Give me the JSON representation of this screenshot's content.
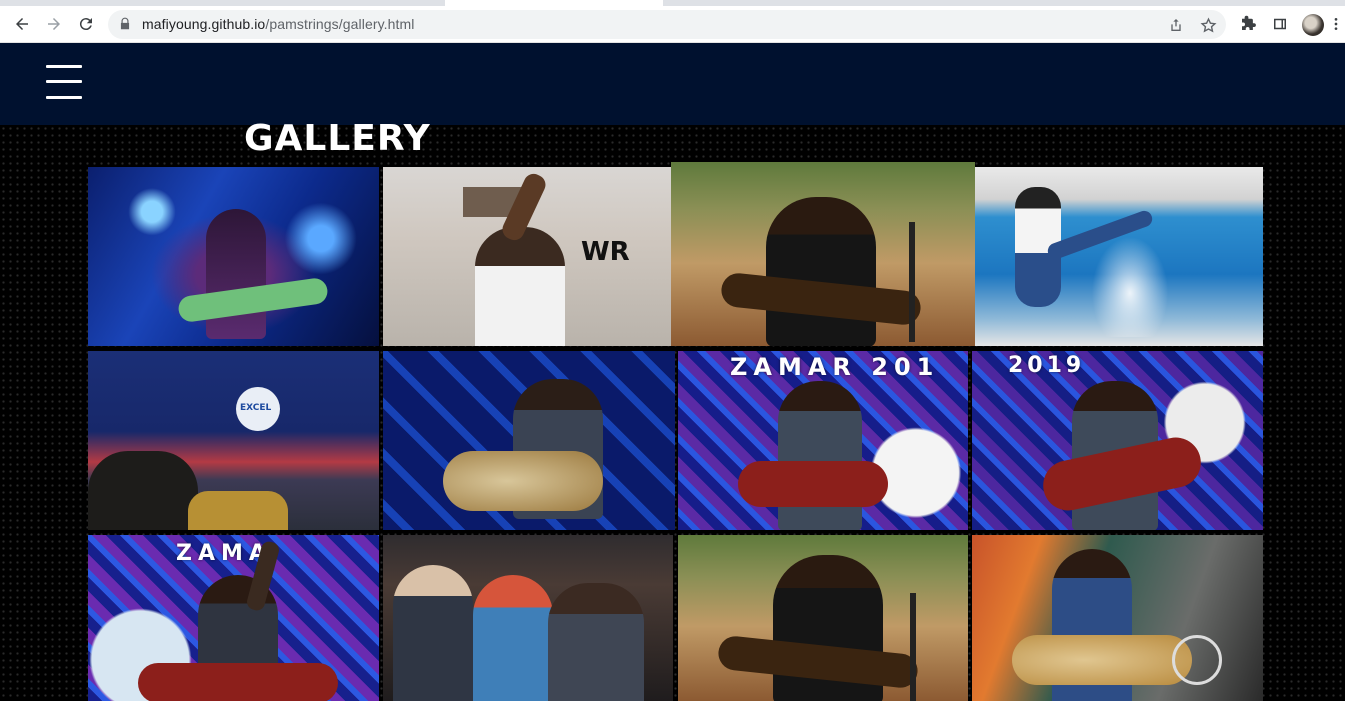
{
  "browser": {
    "url_host": "mafiyoung.github.io",
    "url_path": "/pamstrings/gallery.html",
    "icons": [
      "back-icon",
      "forward-icon",
      "reload-icon",
      "lock-icon",
      "share-icon",
      "star-icon",
      "extensions-icon",
      "side-panel-icon",
      "profile-avatar",
      "menu-dots-icon"
    ]
  },
  "site": {
    "header_color": "#00112f",
    "menu_icon": "hamburger-menu-icon",
    "gallery_title": "GALLERY"
  },
  "gallery": {
    "photos": [
      {
        "name": "photo-stage-guitar-blue-stars",
        "caption": ""
      },
      {
        "name": "photo-worship-raised-hand",
        "caption": "WR"
      },
      {
        "name": "photo-seated-guitar-outdoors",
        "caption": ""
      },
      {
        "name": "photo-lake-kick-splash",
        "caption": ""
      },
      {
        "name": "photo-church-stage-choir",
        "caption": "EXCEL"
      },
      {
        "name": "photo-acoustic-blue-diamonds",
        "caption": ""
      },
      {
        "name": "photo-zamar-2019-guitar-a",
        "caption": "ZAMAR 201"
      },
      {
        "name": "photo-zamar-2019-guitar-b",
        "caption": "2019"
      },
      {
        "name": "photo-zamar-raised-arm",
        "caption": "ZAMA"
      },
      {
        "name": "photo-audience-guests",
        "caption": ""
      },
      {
        "name": "photo-seated-guitar-outdoors-2",
        "caption": ""
      },
      {
        "name": "photo-orange-stage-guitar",
        "caption": ""
      }
    ]
  }
}
